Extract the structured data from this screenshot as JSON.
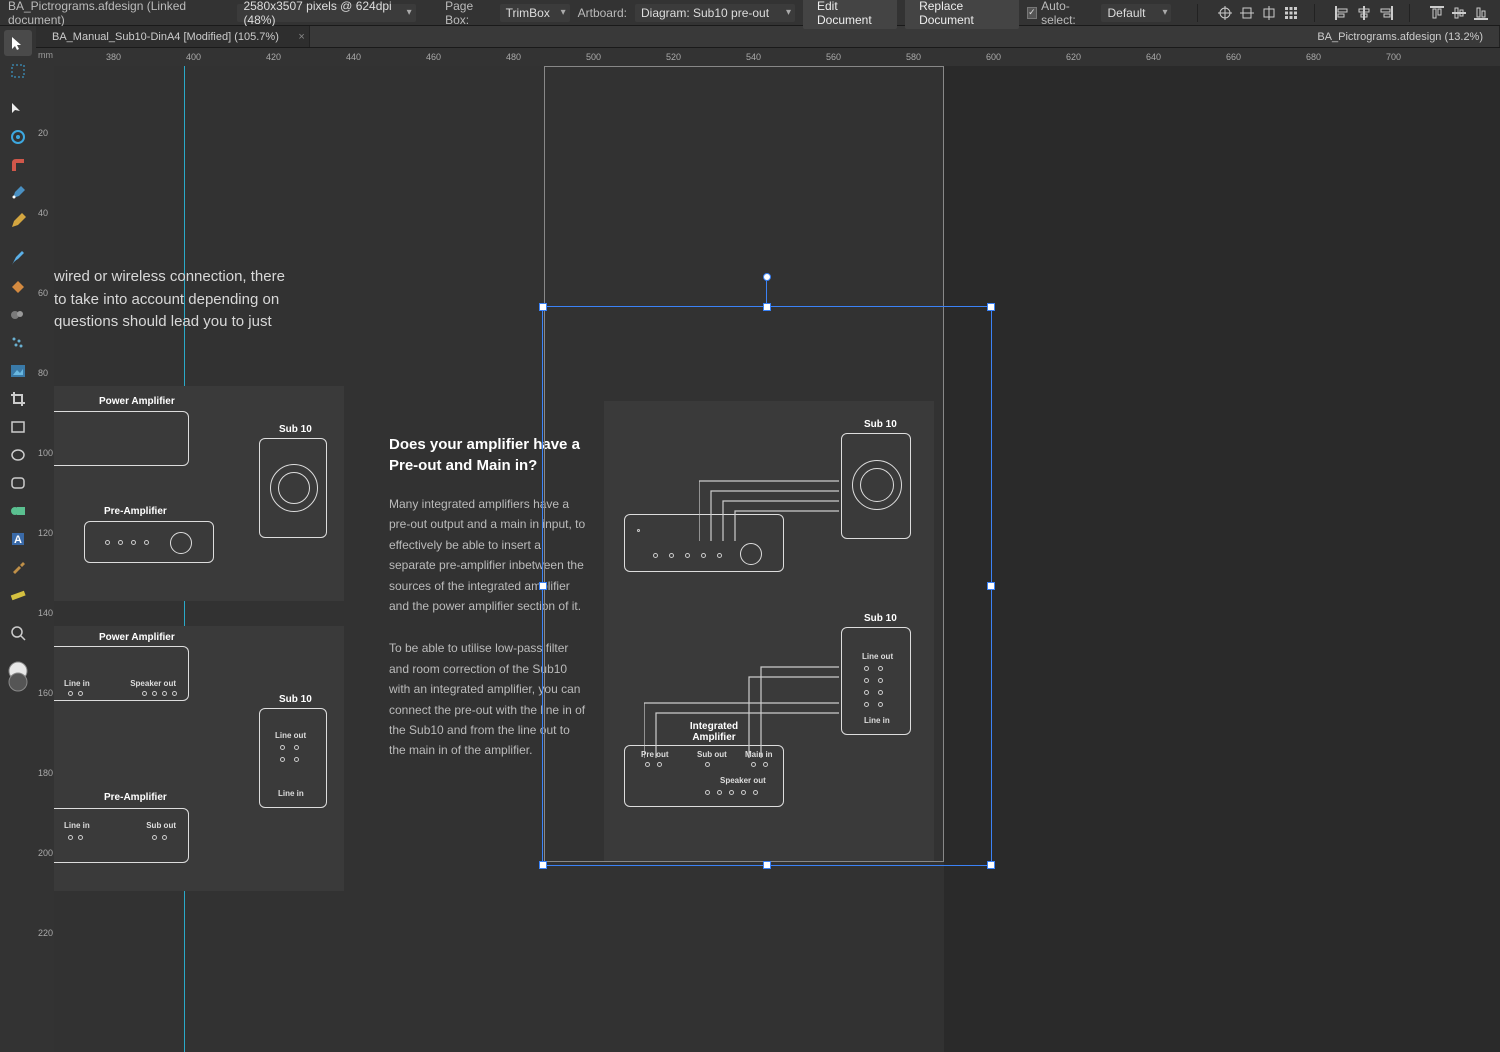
{
  "context": {
    "docname": "BA_Pictrograms.afdesign (Linked document)",
    "dimensions": "2580x3507 pixels @ 624dpi (48%)",
    "pagebox_label": "Page Box:",
    "pagebox_value": "TrimBox",
    "artboard_label": "Artboard:",
    "artboard_value": "Diagram: Sub10 pre-out",
    "edit_btn": "Edit Document",
    "replace_btn": "Replace Document",
    "autosel_label": "Auto-select:",
    "autosel_value": "Default"
  },
  "tabs": {
    "t1": "BA_Manual_Sub10-DinA4 [Modified] (105.7%)",
    "t2": "BA_Pictrograms.afdesign (13.2%)"
  },
  "ruler": {
    "unit": "mm",
    "h": [
      "380",
      "400",
      "420",
      "440",
      "460",
      "480",
      "500",
      "520",
      "540",
      "560",
      "580",
      "600",
      "620",
      "640",
      "660",
      "680",
      "700"
    ],
    "v": [
      "20",
      "40",
      "60",
      "80",
      "100",
      "120",
      "140",
      "160",
      "180",
      "200",
      "220"
    ]
  },
  "content": {
    "intro_l1": "wired or wireless connection, there",
    "intro_l2": "to take into account depending on",
    "intro_l3": "questions should lead you to just",
    "q_title_l1": "Does your amplifier have a",
    "q_title_l2": "Pre-out and Main in?",
    "p1": "Many integrated amplifiers have a pre-out output and a main in input, to effectively be able to insert a separate pre-amplifier inbetween the sources of the integrated amplifier and the power amplifier section of it.",
    "p2": "To be able to utilise low-pass filter and room correction of the Sub10 with an integrated amplifier, you can connect the pre-out with the line in of the Sub10 and from the line out to the main in of the amplifier."
  },
  "labels": {
    "power_amp": "Power Amplifier",
    "pre_amp": "Pre-Amplifier",
    "sub10": "Sub 10",
    "integrated": "Integrated",
    "amplifier": "Amplifier",
    "speaker_out": "Speaker out",
    "line_out": "Line out",
    "line_in": "Line in",
    "pre_out": "Pre out",
    "sub_out": "Sub out",
    "main_in": "Main in"
  }
}
